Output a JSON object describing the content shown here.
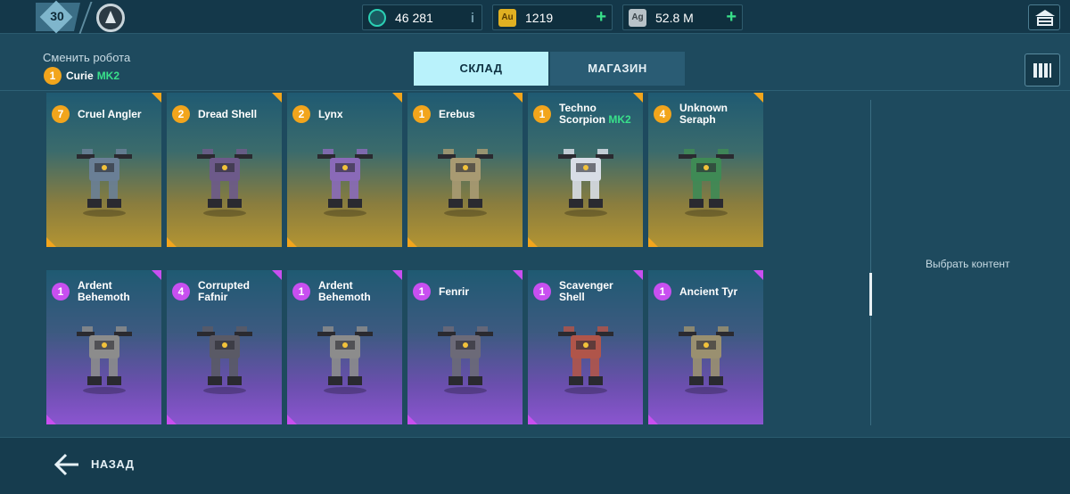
{
  "header": {
    "player_level": "30",
    "currencies": [
      {
        "name": "power-cells",
        "value": "46 281",
        "extra": "i",
        "icon_color": "#2bd0b4"
      },
      {
        "name": "gold",
        "icon_text": "Au",
        "value": "1219",
        "extra": "+",
        "icon_color": "#e0b022"
      },
      {
        "name": "silver",
        "icon_text": "Ag",
        "value": "52.8 M",
        "extra": "+",
        "icon_color": "#b8c2c8"
      }
    ]
  },
  "robot_select": {
    "label": "Сменить робота",
    "current_level": "1",
    "current_name": "Curie",
    "current_mk": "MK2"
  },
  "tabs": {
    "storage": "СКЛАД",
    "shop": "МАГАЗИН"
  },
  "cards": [
    {
      "level": "7",
      "name": "Cruel Angler",
      "mk": "",
      "rarity": "legendary",
      "color": "#6a7f96"
    },
    {
      "level": "2",
      "name": "Dread Shell",
      "mk": "",
      "rarity": "legendary",
      "color": "#6d5a8a"
    },
    {
      "level": "2",
      "name": "Lynx",
      "mk": "",
      "rarity": "legendary",
      "color": "#8a6ab8"
    },
    {
      "level": "1",
      "name": "Erebus",
      "mk": "",
      "rarity": "legendary",
      "color": "#a89a72"
    },
    {
      "level": "1",
      "name": "Techno Scorpion",
      "mk": "MK2",
      "rarity": "legendary",
      "color": "#d8dde6"
    },
    {
      "level": "4",
      "name": "Unknown Seraph",
      "mk": "",
      "rarity": "legendary",
      "color": "#3f8a55"
    },
    {
      "level": "1",
      "name": "Ardent Behemoth",
      "mk": "",
      "rarity": "epic",
      "color": "#8c8c8c"
    },
    {
      "level": "4",
      "name": "Corrupted Fafnir",
      "mk": "",
      "rarity": "epic",
      "color": "#5a5a66"
    },
    {
      "level": "1",
      "name": "Ardent Behemoth",
      "mk": "",
      "rarity": "epic",
      "color": "#8c8c8c"
    },
    {
      "level": "1",
      "name": "Fenrir",
      "mk": "",
      "rarity": "epic",
      "color": "#6c6a78"
    },
    {
      "level": "1",
      "name": "Scavenger Shell",
      "mk": "",
      "rarity": "epic",
      "color": "#b0554a"
    },
    {
      "level": "1",
      "name": "Ancient Tyr",
      "mk": "",
      "rarity": "epic",
      "color": "#9a9070"
    }
  ],
  "side_panel": {
    "select_content": "Выбрать контент"
  },
  "footer": {
    "back_label": "НАЗАД"
  },
  "colors": {
    "accent_mk": "#39e08a",
    "legendary": "#f2a51c",
    "epic": "#c84ff0",
    "tab_active": "#b9f2fb"
  }
}
